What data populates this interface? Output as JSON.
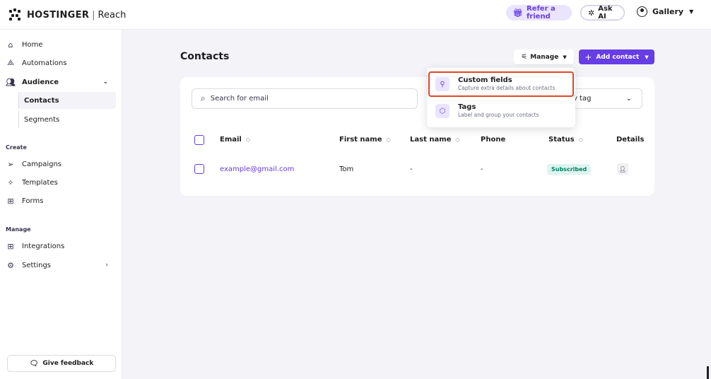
{
  "app": {
    "brand": "HOSTINGER",
    "product": "Reach"
  },
  "header": {
    "refer": "Refer a friend",
    "ask_ai": "Ask AI",
    "account": "Gallery"
  },
  "sidebar": {
    "home": "Home",
    "automations": "Automations",
    "audience": "Audience",
    "contacts": "Contacts",
    "segments": "Segments",
    "create_label": "Create",
    "campaigns": "Campaigns",
    "templates": "Templates",
    "forms": "Forms",
    "manage_label": "Manage",
    "integrations": "Integrations",
    "settings": "Settings",
    "feedback": "Give feedback"
  },
  "main": {
    "title": "Contacts",
    "manage_button": "Manage",
    "add_button": "Add contact",
    "search_placeholder": "Search for email",
    "filter_tag": "y tag",
    "columns": {
      "email": "Email",
      "first_name": "First name",
      "last_name": "Last name",
      "phone": "Phone",
      "status": "Status",
      "details": "Details"
    },
    "rows": [
      {
        "email": "example@gmail.com",
        "first_name": "Tom",
        "last_name": "-",
        "phone": "-",
        "status": "Subscribed"
      }
    ]
  },
  "dropdown": {
    "items": [
      {
        "title": "Custom fields",
        "desc": "Capture extra details about contacts"
      },
      {
        "title": "Tags",
        "desc": "Label and group your contacts"
      }
    ]
  },
  "colors": {
    "accent": "#673de6",
    "highlight": "#e0452b",
    "success": "#008361"
  }
}
